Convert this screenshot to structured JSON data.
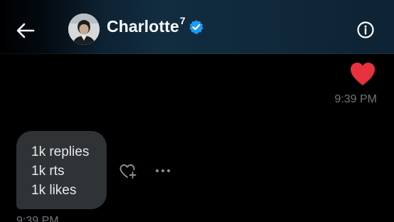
{
  "header": {
    "title": "Charlotte",
    "title_superscript": "7",
    "verified": true,
    "back_icon": "arrow-left-icon",
    "info_icon": "info-circle-icon",
    "avatar_icon": "user-avatar"
  },
  "messages": {
    "sent": {
      "content_icon": "heart-emoji",
      "time": "9:39 PM"
    },
    "received": {
      "lines": [
        "1k replies",
        "1k rts",
        "1k likes"
      ],
      "time": "9:39 PM",
      "react_icon": "heart-plus-icon",
      "more_icon": "more-horizontal-icon"
    }
  },
  "colors": {
    "background": "#000000",
    "header_accent": "#122c40",
    "verified_badge": "#1d9bf0",
    "heart": "#f91880",
    "bubble": "#2f3336",
    "secondary_text": "#71767b"
  }
}
